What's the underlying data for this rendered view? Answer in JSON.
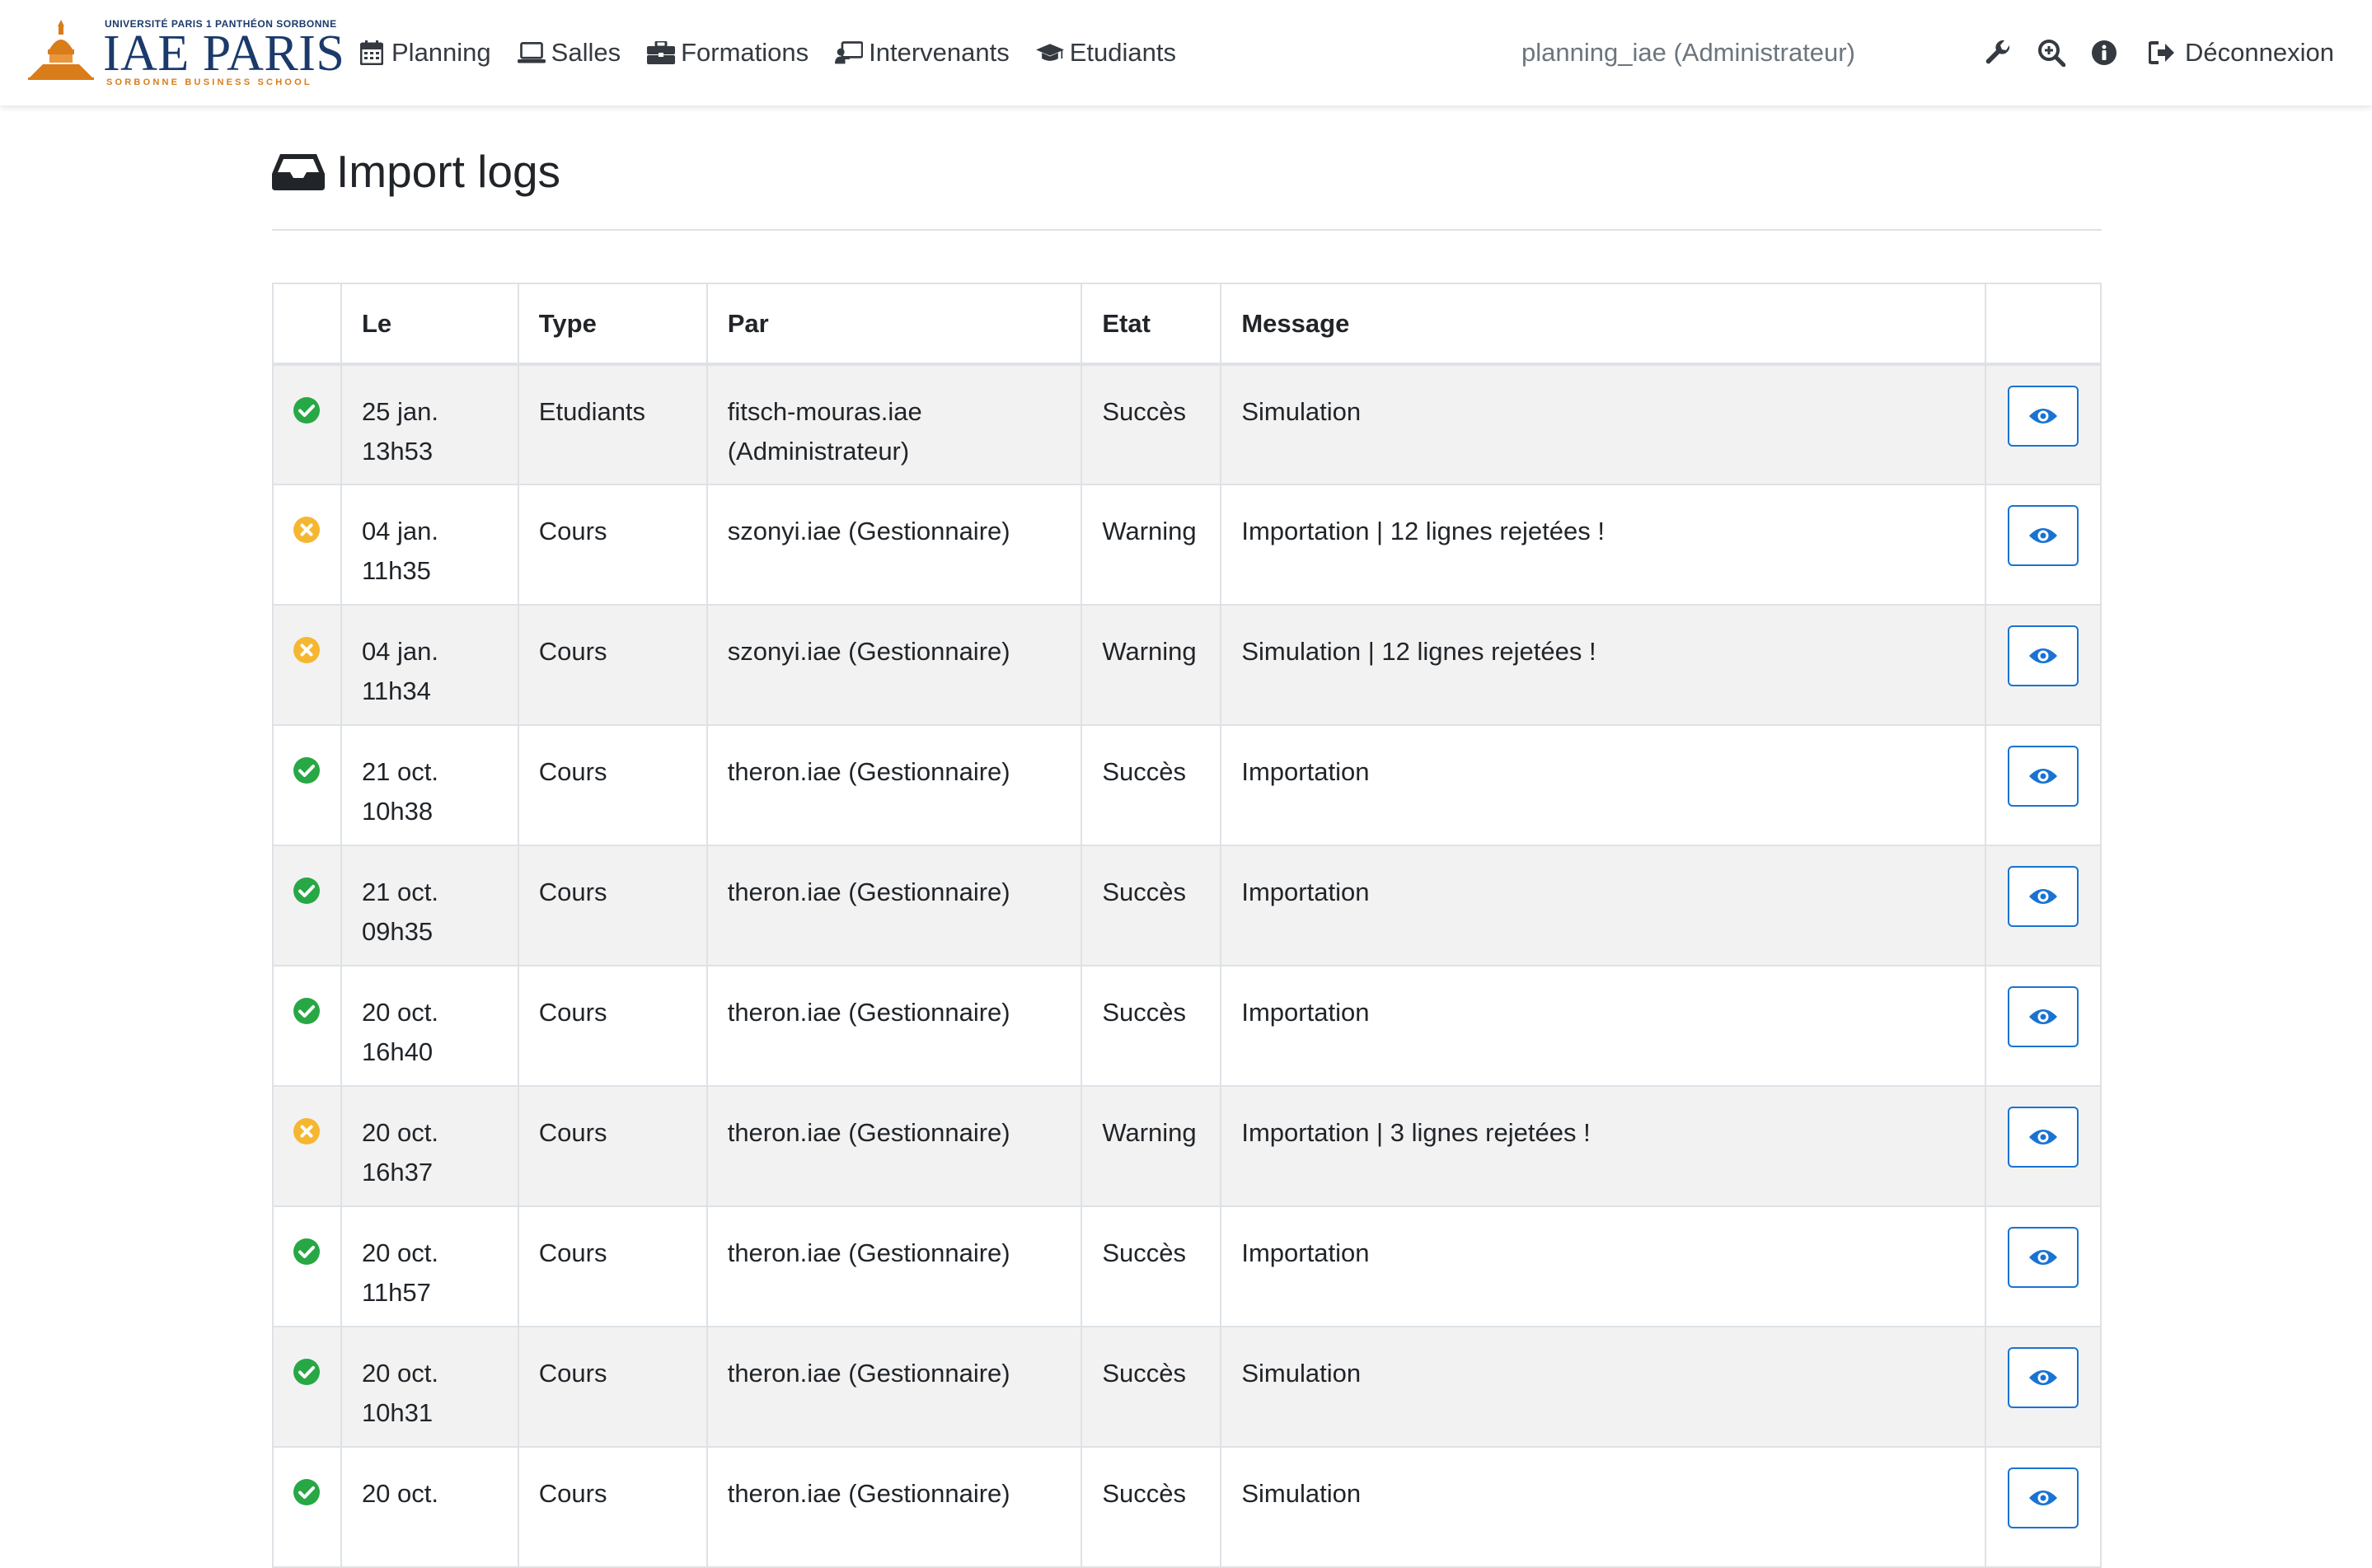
{
  "brand": {
    "top_text": "UNIVERSITÉ PARIS 1 PANTHÉON SORBONNE",
    "name": "IAE PARIS",
    "subtitle": "SORBONNE BUSINESS SCHOOL",
    "logo_icon": "building-logo-icon"
  },
  "nav": {
    "links": [
      {
        "label": "Planning",
        "icon": "calendar-icon"
      },
      {
        "label": "Salles",
        "icon": "laptop-icon"
      },
      {
        "label": "Formations",
        "icon": "briefcase-icon"
      },
      {
        "label": "Intervenants",
        "icon": "chalkboard-teacher-icon"
      },
      {
        "label": "Etudiants",
        "icon": "graduation-cap-icon"
      }
    ],
    "user": "planning_iae (Administrateur)",
    "icons": [
      "wrench-icon",
      "search-plus-icon",
      "info-circle-icon"
    ],
    "logout": "Déconnexion"
  },
  "page": {
    "title": "Import logs",
    "title_icon": "inbox-icon"
  },
  "table": {
    "headers": [
      "",
      "Le",
      "Type",
      "Par",
      "Etat",
      "Message",
      ""
    ],
    "rows": [
      {
        "status": "success",
        "date": "25 jan.",
        "time": "13h53",
        "type": "Etudiants",
        "by": "fitsch-mouras.iae (Administrateur)",
        "state": "Succès",
        "message": "Simulation"
      },
      {
        "status": "warning",
        "date": "04 jan.",
        "time": "11h35",
        "type": "Cours",
        "by": "szonyi.iae (Gestionnaire)",
        "state": "Warning",
        "message": "Importation | 12 lignes rejetées !"
      },
      {
        "status": "warning",
        "date": "04 jan.",
        "time": "11h34",
        "type": "Cours",
        "by": "szonyi.iae (Gestionnaire)",
        "state": "Warning",
        "message": "Simulation | 12 lignes rejetées !"
      },
      {
        "status": "success",
        "date": "21 oct.",
        "time": "10h38",
        "type": "Cours",
        "by": "theron.iae (Gestionnaire)",
        "state": "Succès",
        "message": "Importation"
      },
      {
        "status": "success",
        "date": "21 oct.",
        "time": "09h35",
        "type": "Cours",
        "by": "theron.iae (Gestionnaire)",
        "state": "Succès",
        "message": "Importation"
      },
      {
        "status": "success",
        "date": "20 oct.",
        "time": "16h40",
        "type": "Cours",
        "by": "theron.iae (Gestionnaire)",
        "state": "Succès",
        "message": "Importation"
      },
      {
        "status": "warning",
        "date": "20 oct.",
        "time": "16h37",
        "type": "Cours",
        "by": "theron.iae (Gestionnaire)",
        "state": "Warning",
        "message": "Importation | 3 lignes rejetées !"
      },
      {
        "status": "success",
        "date": "20 oct.",
        "time": "11h57",
        "type": "Cours",
        "by": "theron.iae (Gestionnaire)",
        "state": "Succès",
        "message": "Importation"
      },
      {
        "status": "success",
        "date": "20 oct.",
        "time": "10h31",
        "type": "Cours",
        "by": "theron.iae (Gestionnaire)",
        "state": "Succès",
        "message": "Simulation"
      },
      {
        "status": "success",
        "date": "20 oct.",
        "time": "",
        "type": "Cours",
        "by": "theron.iae (Gestionnaire)",
        "state": "Succès",
        "message": "Simulation"
      }
    ],
    "view_icon": "eye-icon"
  },
  "colors": {
    "success": "#28a745",
    "warning": "#f5b731",
    "primary": "#1a73d1",
    "brand_navy": "#1b3a6b",
    "brand_orange": "#d97c1a"
  }
}
